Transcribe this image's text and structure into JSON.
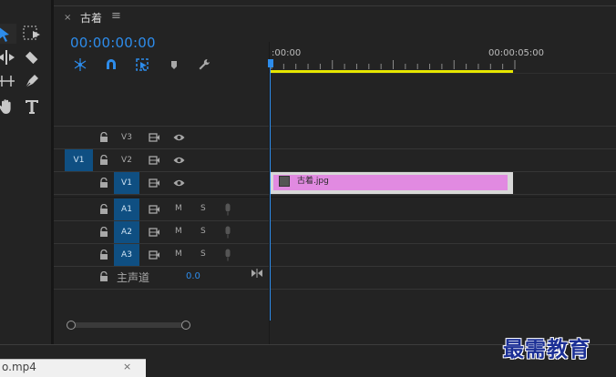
{
  "tools": [
    "selection-tool",
    "track-select-tool",
    "ripple-edit-tool",
    "razor-tool",
    "slip-tool",
    "pen-tool",
    "hand-tool",
    "type-tool"
  ],
  "panel": {
    "close_glyph": "×",
    "sequence_name": "古着",
    "menu_glyph": "≡"
  },
  "timecode": "00:00:00:00",
  "controls": [
    "snap-insert-icon",
    "magnet-icon",
    "linked-selection-icon",
    "marker-icon",
    "wrench-icon"
  ],
  "ruler": {
    "label_start": ":00:00",
    "label_end": "00:00:05:00"
  },
  "tracks": {
    "v3": {
      "name": "V3"
    },
    "v2": {
      "name": "V2"
    },
    "v1": {
      "name": "V1",
      "source_patch": "V1"
    },
    "a1": {
      "name": "A1",
      "m": "M",
      "s": "S"
    },
    "a2": {
      "name": "A2",
      "m": "M",
      "s": "S"
    },
    "a3": {
      "name": "A3",
      "m": "M",
      "s": "S"
    }
  },
  "master": {
    "label": "主声道",
    "value": "0.0"
  },
  "clip": {
    "name": "古着.jpg",
    "color": "#e18ae1"
  },
  "bottom_tab": {
    "file_name": "o.mp4",
    "close_glyph": "×"
  },
  "watermark": "最需教育",
  "colors": {
    "accent": "#2d8ceb",
    "track_active": "#0f4f82",
    "work_area": "#e6e600"
  }
}
